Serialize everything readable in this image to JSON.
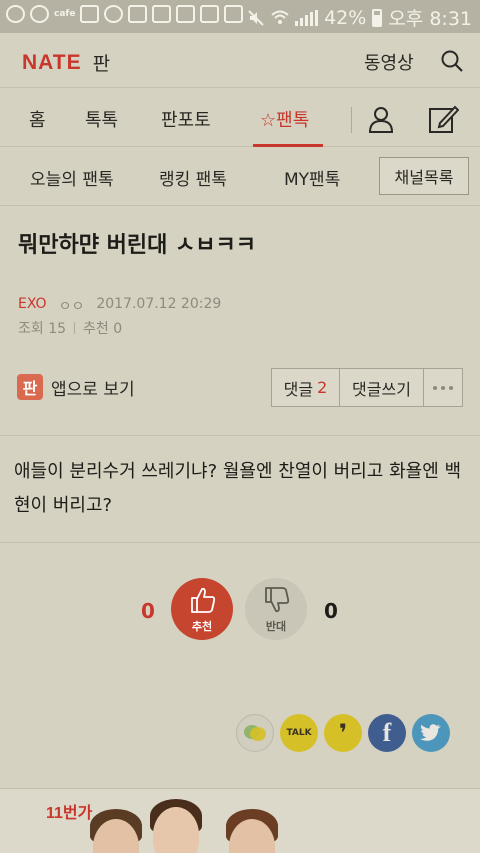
{
  "status_bar": {
    "cafe_label": "cafe",
    "battery": "42%",
    "clock": "오후 8:31"
  },
  "header": {
    "logo_nate": "NATE",
    "logo_pann": "판",
    "video_link": "동영상"
  },
  "main_nav": {
    "items": [
      "홈",
      "톡톡",
      "판포토",
      "팬톡"
    ],
    "active": "팬톡"
  },
  "sub_nav": {
    "items": [
      "오늘의 팬톡",
      "랭킹 팬톡",
      "MY팬톡"
    ],
    "channel_button": "채널목록"
  },
  "post": {
    "title": "뭐만하먄 버린대 ㅅㅂㅋㅋ",
    "board": "EXO",
    "author": "ㅇㅇ",
    "datetime": "2017.07.12 20:29",
    "views": "조회 15",
    "recommend": "추천 0",
    "app_icon_text": "판",
    "app_view": "앱으로 보기",
    "comment_label": "댓글",
    "comment_count": "2",
    "write_comment": "댓글쓰기",
    "body": "애들이 분리수거 쓰레기냐? 월욜엔 찬열이 버리고 화욜엔 백현이 버리고?"
  },
  "vote": {
    "up_count": "0",
    "up_label": "추천",
    "down_label": "반대",
    "down_count": "0"
  },
  "share": {
    "talk_label": "TALK",
    "facebook": "f"
  },
  "ad": {
    "logo": "11번가"
  },
  "colors": {
    "brand_red": "#c9372c",
    "kakao_yellow": "#d6c027",
    "facebook_blue": "#3f5d8f",
    "twitter_blue": "#4c96bb"
  }
}
